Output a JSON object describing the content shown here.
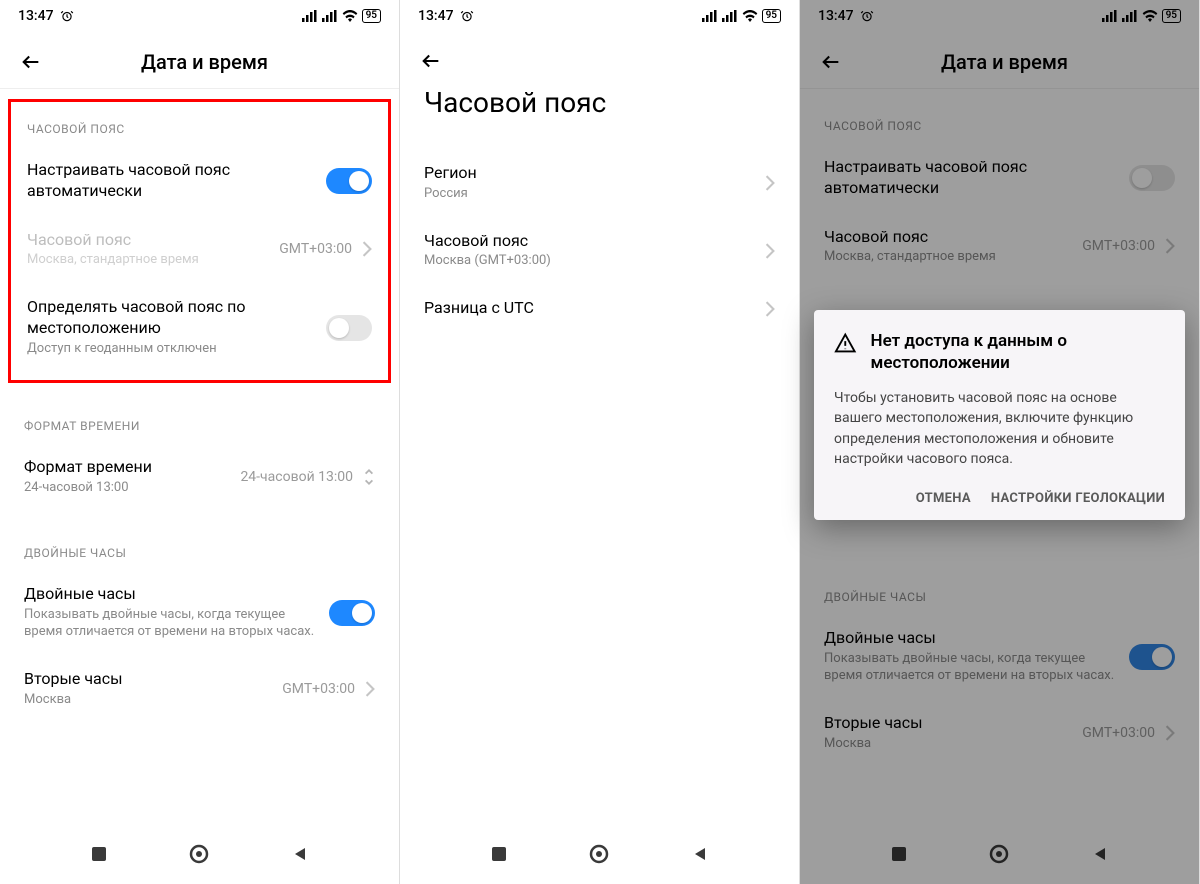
{
  "status": {
    "time": "13:47",
    "battery": "95"
  },
  "screen1": {
    "title": "Дата и время",
    "section_tz": "ЧАСОВОЙ ПОЯС",
    "auto_tz": "Настраивать часовой пояс автоматически",
    "tz_label": "Часовой пояс",
    "tz_sub": "Москва, стандартное время",
    "tz_value": "GMT+03:00",
    "geo_title": "Определять часовой пояс по местоположению",
    "geo_sub": "Доступ к геоданным отключен",
    "section_fmt": "ФОРМАТ ВРЕМЕНИ",
    "fmt_title": "Формат времени",
    "fmt_sub": "24-часовой 13:00",
    "fmt_value": "24-часовой 13:00",
    "section_dual": "ДВОЙНЫЕ ЧАСЫ",
    "dual_title": "Двойные часы",
    "dual_sub": "Показывать двойные часы, когда текущее время отличается от времени на вторых часах.",
    "second_title": "Вторые часы",
    "second_sub": "Москва",
    "second_value": "GMT+03:00"
  },
  "screen2": {
    "big_title": "Часовой пояс",
    "region_title": "Регион",
    "region_sub": "Россия",
    "tz_title": "Часовой пояс",
    "tz_sub": "Москва (GMT+03:00)",
    "utc_title": "Разница с UTC"
  },
  "screen3": {
    "title": "Дата и время",
    "dialog_title": "Нет доступа к данным о местоположении",
    "dialog_body": "Чтобы установить часовой пояс на основе вашего местоположения, включите функцию определения местоположения и обновите настройки часового пояса.",
    "btn_cancel": "ОТМЕНА",
    "btn_settings": "НАСТРОЙКИ ГЕОЛОКАЦИИ"
  }
}
